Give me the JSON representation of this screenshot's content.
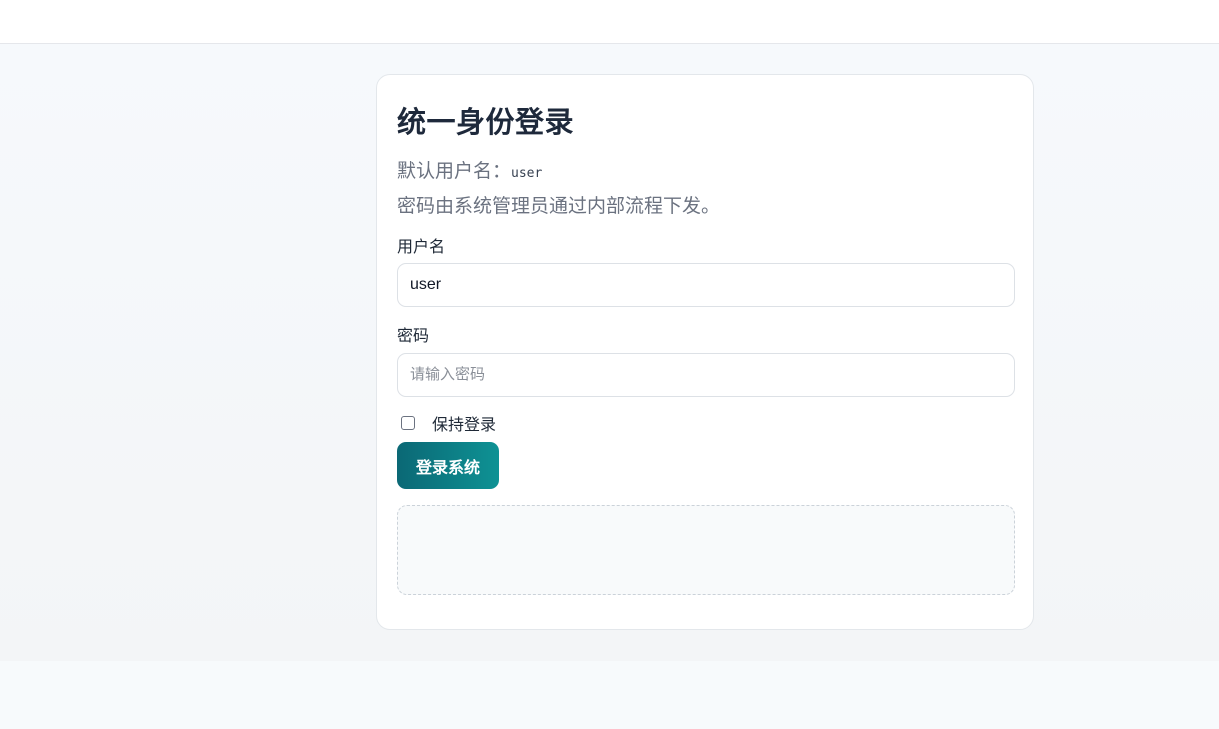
{
  "login": {
    "title": "统一身份登录",
    "default_user_label": "默认用户名：",
    "default_user_value": "user",
    "password_note": "密码由系统管理员通过内部流程下发。",
    "username_label": "用户名",
    "username_value": "user",
    "password_label": "密码",
    "password_placeholder": "请输入密码",
    "remember_label": "保持登录",
    "remember_checked": false,
    "submit_label": "登录系统",
    "message": ""
  },
  "colors": {
    "accent_start": "#0b6875",
    "accent_end": "#0e9294",
    "title": "#1e293b",
    "muted_text": "#6b7280"
  }
}
